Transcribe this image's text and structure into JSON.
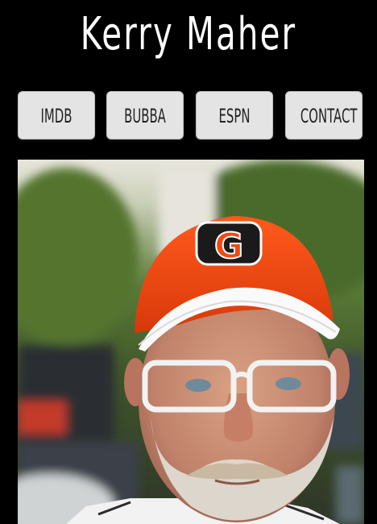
{
  "header": {
    "title": "Kerry Maher"
  },
  "nav": {
    "items": [
      {
        "label": "IMDB"
      },
      {
        "label": "BUBBA"
      },
      {
        "label": "ESPN"
      },
      {
        "label": "CONTACT"
      }
    ]
  },
  "photo": {
    "cap_letter": "G",
    "colors": {
      "cap": "#f04a12",
      "brim": "#ffffff",
      "skin": "#c98f72",
      "beard": "#d8d2c8",
      "foliage": "#4d6a2e"
    }
  }
}
